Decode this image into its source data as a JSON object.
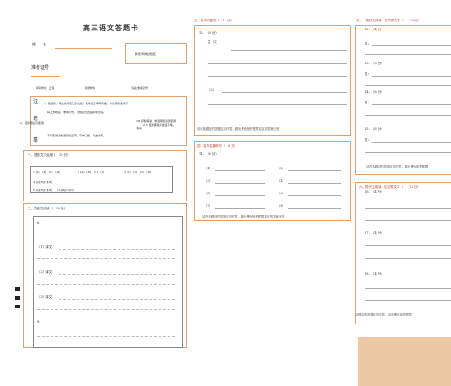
{
  "header": {
    "title": "高三语文答题卡",
    "name_label": "姓　　名",
    "exam_no_label": "准考证号",
    "barcode_label": "条形码粘贴区",
    "fill_row": [
      "填写样例　正确",
      "错误样例",
      "（请在准考证号"
    ]
  },
  "notes": {
    "title_chars": [
      "注",
      "意",
      "事"
    ],
    "items": [
      "1、答题前，考生先将自己的姓名、准考证号填写清楚，并认真核准条形",
      "码上的姓名、准考证号，在规定位置贴好条形码。",
      "2、选择题必须使用",
      "2B 铅笔填涂；非选择题必须使用",
      "0.5 毫米黑色字迹签字笔。",
      "书写",
      "不得使用涂改液和修正带。字体工整，笔迹清晰。"
    ]
  },
  "section1": {
    "title": "一、语言文字运用（　10 分）",
    "options": [
      {
        "num": "1",
        "choices": [
          "A",
          "B",
          "C",
          "D"
        ]
      },
      {
        "num": "2",
        "choices": [
          "A",
          "B",
          "C",
          "D"
        ]
      },
      {
        "num": "3",
        "choices": [
          "A",
          "B",
          "C",
          "D"
        ]
      },
      {
        "num": "4",
        "choices": [
          "A",
          "B",
          "C",
          "D"
        ]
      },
      {
        "num": "5",
        "choices": [
          "A",
          "B",
          "C",
          "D"
        ]
      }
    ]
  },
  "section2": {
    "title": "二、文言文阅读（　30 分）",
    "q_num": "6.",
    "items": [
      "（1）译文：",
      "（2）译文：",
      "（3）译文：",
      "8."
    ]
  },
  "section3": {
    "title": "三、古诗词鉴赏（　11 分）",
    "q_num": "10．（6 分）",
    "items": [
      "答（1）",
      "（2）"
    ],
    "footer": "请在各题目的答题区内作答，超出黑色矩形框限定区的答案无效"
  },
  "section4": {
    "title": "四、名句名篇默写（　6 分）",
    "q_num": "11．（6 分）",
    "rows": [
      [
        "（1）",
        "（2）"
      ],
      [
        "（3）",
        "（4）"
      ],
      [
        "（5）",
        "（6）"
      ],
      [
        "（7）",
        "（8）"
      ]
    ],
    "footer": "请在各题目的答题区内作答，超出黑色矩形框限定区的答案无效"
  },
  "section5": {
    "title": "五、　现代文阅读：文学类文本（　　20 分）",
    "items": [
      {
        "q": "12．（4 分）",
        "ans": "答："
      },
      {
        "q": "13．（5 分）",
        "ans": "答："
      },
      {
        "q": "14．（6 分）",
        "ans": "答："
      },
      {
        "q": "15．（6 分）",
        "ans": "答："
      }
    ],
    "footer": "请在各题目的答题区内作答，超出黑色矩形框限"
  },
  "section6": {
    "title": "六、现代文阅读：论述类文本（　　12 分）",
    "items": [
      "16．（4 分）",
      "17．（4 分）",
      "18．（4 分）"
    ],
    "footer": "各题目的答题区内作答，超出黑色矩形框限"
  },
  "colors": {
    "border_orange": "#e0a070",
    "title_red": "#c0392b",
    "block_fill": "#ecc9a4"
  }
}
